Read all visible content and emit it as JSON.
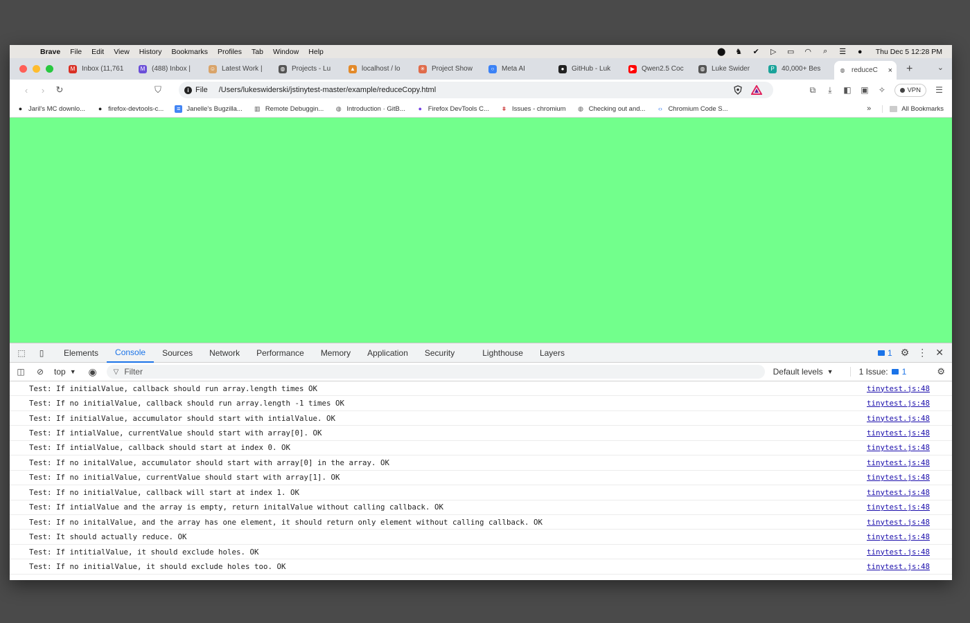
{
  "menubar": {
    "app": "Brave",
    "items": [
      "File",
      "Edit",
      "View",
      "History",
      "Bookmarks",
      "Profiles",
      "Tab",
      "Window",
      "Help"
    ],
    "clock": "Thu Dec 5  12:28 PM"
  },
  "tabs": [
    {
      "label": "Inbox (11,761",
      "icon": "gmail-icon",
      "color": "#d93025",
      "glyph": "M"
    },
    {
      "label": "(488) Inbox |",
      "icon": "mail-icon",
      "color": "#6b4fd8",
      "glyph": "M"
    },
    {
      "label": "Latest Work |",
      "icon": "avatar-icon",
      "color": "#d9a46a",
      "glyph": "☺"
    },
    {
      "label": "Projects - Lu",
      "icon": "globe-icon",
      "color": "#555555",
      "glyph": "◍"
    },
    {
      "label": "localhost / lo",
      "icon": "phpmyadmin-icon",
      "color": "#e38a2a",
      "glyph": "▲"
    },
    {
      "label": "Project Show",
      "icon": "claude-icon",
      "color": "#e06b4a",
      "glyph": "✳"
    },
    {
      "label": "Meta AI",
      "icon": "meta-ai-icon",
      "color": "#3b82f6",
      "glyph": "○"
    },
    {
      "label": "GitHub - Luk",
      "icon": "github-icon",
      "color": "#222222",
      "glyph": "●"
    },
    {
      "label": "Qwen2.5 Coc",
      "icon": "youtube-icon",
      "color": "#ff0000",
      "glyph": "▶"
    },
    {
      "label": "Luke Swider",
      "icon": "globe-icon",
      "color": "#555555",
      "glyph": "◍"
    },
    {
      "label": "40,000+ Bes",
      "icon": "freepik-icon",
      "color": "#1aa39a",
      "glyph": "P"
    }
  ],
  "active_tab": {
    "label": "reduceC",
    "close": "×"
  },
  "toolbar": {
    "scheme": "File",
    "url": "/Users/lukeswiderski/jstinytest-master/example/reduceCopy.html",
    "vpn": "VPN"
  },
  "bookmarks": [
    {
      "label": "Jaril's MC downlo...",
      "icon": "github-icon",
      "color": "#222222",
      "glyph": "●"
    },
    {
      "label": "firefox-devtools-c...",
      "icon": "github-icon",
      "color": "#222222",
      "glyph": "●"
    },
    {
      "label": "Janelle's Bugzilla...",
      "icon": "doc-icon",
      "color": "#4285f4",
      "glyph": "≡"
    },
    {
      "label": "Remote Debuggin...",
      "icon": "book-icon",
      "color": "#555555",
      "glyph": "▥"
    },
    {
      "label": "Introduction · GitB...",
      "icon": "globe-icon",
      "color": "#555555",
      "glyph": "◍"
    },
    {
      "label": "Firefox DevTools C...",
      "icon": "firefox-icon",
      "color": "#7542e5",
      "glyph": "●"
    },
    {
      "label": "Issues - chromium",
      "icon": "bug-icon",
      "color": "#c62828",
      "glyph": "⩩"
    },
    {
      "label": "Checking out and...",
      "icon": "globe-icon",
      "color": "#555555",
      "glyph": "◍"
    },
    {
      "label": "Chromium Code S...",
      "icon": "code-search-icon",
      "color": "#4285f4",
      "glyph": "‹›"
    }
  ],
  "all_bookmarks": "All Bookmarks",
  "page": {
    "background": "#72ff8c"
  },
  "devtools": {
    "tabs": [
      "Elements",
      "Console",
      "Sources",
      "Network",
      "Performance",
      "Memory",
      "Application",
      "Security",
      "Lighthouse",
      "Layers"
    ],
    "active_tab": "Console",
    "issue_count": "1",
    "context": "top",
    "filter_placeholder": "Filter",
    "levels": "Default levels",
    "issues_label": "1 Issue:",
    "issues_count": "1",
    "logs": [
      {
        "msg": "Test: If initialValue, callback should run array.length times OK",
        "src": "tinytest.js:48"
      },
      {
        "msg": "Test: If no initialValue, callback should run array.length -1 times OK",
        "src": "tinytest.js:48"
      },
      {
        "msg": "Test: If initialValue, accumulator should start with intialValue. OK",
        "src": "tinytest.js:48"
      },
      {
        "msg": "Test: If intialValue, currentValue should start with array[0]. OK",
        "src": "tinytest.js:48"
      },
      {
        "msg": "Test: If intialValue, callback should start at index 0. OK",
        "src": "tinytest.js:48"
      },
      {
        "msg": "Test: If no initalValue, accumulator should start with array[0] in the array. OK",
        "src": "tinytest.js:48"
      },
      {
        "msg": "Test: If no initialValue, currentValue should start with array[1]. OK",
        "src": "tinytest.js:48"
      },
      {
        "msg": "Test: If no initialValue, callback will start at index 1. OK",
        "src": "tinytest.js:48"
      },
      {
        "msg": "Test: If intialValue and the array is empty, return initalValue without calling callback. OK",
        "src": "tinytest.js:48"
      },
      {
        "msg": "Test: If no initalValue, and the array has one element, it should return only element without calling callback. OK",
        "src": "tinytest.js:48"
      },
      {
        "msg": "Test: It should actually reduce. OK",
        "src": "tinytest.js:48"
      },
      {
        "msg": "Test: If intitialValue, it should exclude holes. OK",
        "src": "tinytest.js:48"
      },
      {
        "msg": "Test: If no initialValue, it should exclude holes too. OK",
        "src": "tinytest.js:48"
      }
    ]
  }
}
